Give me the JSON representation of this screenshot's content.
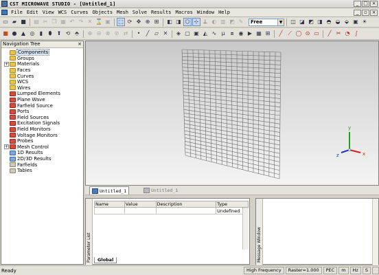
{
  "window": {
    "title": "CST MICROWAVE STUDIO - [Untitled_1]"
  },
  "menu": [
    "File",
    "Edit",
    "View",
    "WCS",
    "Curves",
    "Objects",
    "Mesh",
    "Solve",
    "Results",
    "Macros",
    "Window",
    "Help"
  ],
  "toolbar": {
    "view_mode": "Free"
  },
  "nav": {
    "title": "Navigation Tree",
    "items": [
      {
        "label": "Components",
        "icon": "folder",
        "expander": false,
        "selected": true
      },
      {
        "label": "Groups",
        "icon": "folder",
        "expander": false
      },
      {
        "label": "Materials",
        "icon": "folder",
        "expander": true
      },
      {
        "label": "Faces",
        "icon": "folder",
        "expander": false
      },
      {
        "label": "Curves",
        "icon": "folder",
        "expander": false
      },
      {
        "label": "WCS",
        "icon": "folder",
        "expander": false
      },
      {
        "label": "Wires",
        "icon": "folder",
        "expander": false
      },
      {
        "label": "Lumped Elements",
        "icon": "folder-red",
        "expander": false
      },
      {
        "label": "Plane Wave",
        "icon": "folder-red",
        "expander": false
      },
      {
        "label": "Farfield Source",
        "icon": "folder-red",
        "expander": false
      },
      {
        "label": "Ports",
        "icon": "folder-red",
        "expander": false
      },
      {
        "label": "Field Sources",
        "icon": "folder-red",
        "expander": false
      },
      {
        "label": "Excitation Signals",
        "icon": "folder-red",
        "expander": false
      },
      {
        "label": "Field Monitors",
        "icon": "folder-red",
        "expander": false
      },
      {
        "label": "Voltage Monitors",
        "icon": "folder-red",
        "expander": false
      },
      {
        "label": "Probes",
        "icon": "folder-red",
        "expander": false
      },
      {
        "label": "Mesh Control",
        "icon": "folder-red",
        "expander": true
      },
      {
        "label": "1D Results",
        "icon": "folder-blue",
        "expander": false
      },
      {
        "label": "2D/3D Results",
        "icon": "folder-blue",
        "expander": false
      },
      {
        "label": "Farfields",
        "icon": "folder-gray",
        "expander": false
      },
      {
        "label": "Tables",
        "icon": "folder-gray",
        "expander": false
      }
    ]
  },
  "viewport": {
    "axes": {
      "x": "x",
      "y": "y",
      "z": "z"
    },
    "colors": {
      "x": "#d02020",
      "y": "#20a020",
      "z": "#2030c0"
    }
  },
  "tabs": [
    {
      "label": "Untitled_1",
      "active": true
    },
    {
      "label": "Untitled_1",
      "active": false
    }
  ],
  "parameter_list": {
    "title": "Parameter List",
    "columns": [
      "Name",
      "Value",
      "Description",
      "Type"
    ],
    "rows": [
      {
        "name": "",
        "value": "",
        "description": "",
        "type": "Undefined"
      }
    ],
    "tab": "Global"
  },
  "message_window": {
    "title": "Message Window"
  },
  "status": {
    "text": "Ready",
    "frequency": "High Frequency",
    "raster": "Raster=1.000",
    "mode": "PEC",
    "units": [
      "m",
      "Hz",
      "S"
    ]
  }
}
